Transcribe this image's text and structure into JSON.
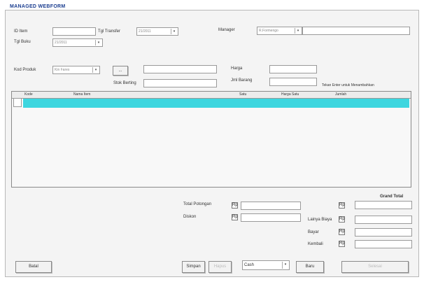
{
  "window": {
    "title": "MANAGED WEBFORM"
  },
  "header": {
    "id_label": "ID Item",
    "id_value": "",
    "type_label": "Tgl Transfer",
    "type_value": "21/2011",
    "manager_label": "Manager",
    "manager_value": "R.Formengo",
    "date_label": "Tgl Buku",
    "date_value": "21/2011"
  },
  "entry": {
    "product_label": "Kod Produk",
    "product_value": "Kin Fares",
    "code_button": "...",
    "desc_value": "",
    "qty_label": "Stok Berting",
    "qty_value": "",
    "price_label": "Harga",
    "price_value": "",
    "disc_label": "Jml Barang",
    "disc_value": "",
    "hint": "Tekan Enter untuk Menambahkan"
  },
  "grid": {
    "columns": [
      "Kode",
      "Nama Item",
      "Satu",
      "Harga  Satu",
      "Jumlah"
    ],
    "rows": [
      {
        "kode": "",
        "nama": "",
        "satu": "",
        "harga": "",
        "jumlah": ""
      }
    ]
  },
  "totals": {
    "grand_total_label": "Grand Total",
    "subtotal_label": "Total Potongan",
    "subtotal_chk": "Rp",
    "subtotal_value": "",
    "discount_label": "Diskon",
    "discount_chk": "Rp",
    "discount_value": "",
    "right1_chk": "Rp",
    "right1_value": "",
    "tax_label": "Lainya Biaya",
    "tax_chk": "Rp",
    "tax_value": "",
    "bank_label": "Bayar",
    "bank_chk": "Rp",
    "bank_value": "",
    "change_label": "Kembali",
    "change_chk": "Rp",
    "change_value": ""
  },
  "footer": {
    "cancel_label": "Batal",
    "save_label": "Simpan",
    "edit_label": "Hapus",
    "print_options": [
      "Cash"
    ],
    "print_selected": "Cash",
    "new_label": "Baru",
    "close_label": "Selesai"
  }
}
